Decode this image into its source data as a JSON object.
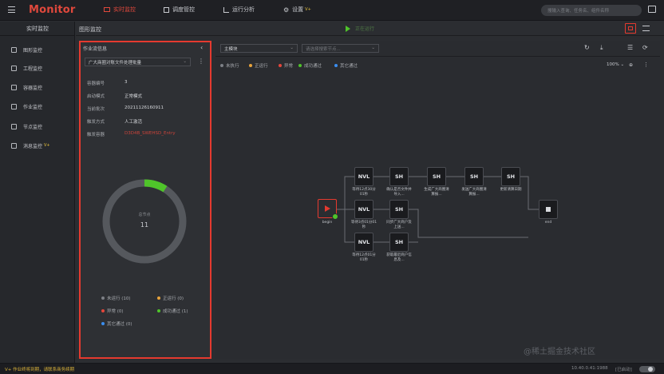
{
  "app": {
    "title": "Monitor"
  },
  "nav": {
    "tabs": [
      {
        "label": "实时监控",
        "active": true
      },
      {
        "label": "调度管控",
        "active": false
      },
      {
        "label": "运行分析",
        "active": false
      },
      {
        "label": "设置",
        "active": false,
        "badge": "V+"
      }
    ],
    "search_placeholder": "搜输入查询、任务名、组件名称"
  },
  "sidebar": {
    "title": "实时监控",
    "items": [
      {
        "label": "图形监控"
      },
      {
        "label": "工程监控"
      },
      {
        "label": "容器监控"
      },
      {
        "label": "作业监控"
      },
      {
        "label": "节点监控"
      },
      {
        "label": "消息监控",
        "badge": "V+"
      }
    ]
  },
  "header": {
    "title": "图形监控",
    "status": "正在运行"
  },
  "panel": {
    "title": "作业流信息",
    "job_select": "广大商圈对账文件处理批量",
    "fields": [
      {
        "label": "容器编号",
        "value": "3"
      },
      {
        "label": "启动模式",
        "value": "正常模式"
      },
      {
        "label": "当前批次",
        "value": "20211126160911"
      },
      {
        "label": "触发方式",
        "value": "人工激活"
      },
      {
        "label": "触发容器",
        "value": "D3D4B_SWEHSD_Entry"
      }
    ],
    "donut": {
      "center_label": "总节点",
      "total": "11",
      "completed": 1
    },
    "legend": [
      {
        "label": "未运行 (10)",
        "color": "#7d8086"
      },
      {
        "label": "正运行 (0)",
        "color": "#e8a33c"
      },
      {
        "label": "异常 (0)",
        "color": "#e5463b"
      },
      {
        "label": "成功通过 (1)",
        "color": "#4fc42a"
      },
      {
        "label": "其它通过 (0)",
        "color": "#3a8ef0"
      }
    ]
  },
  "canvas": {
    "module_select": "主模块",
    "node_search_placeholder": "请选择搜索节点...",
    "zoom": "100%",
    "legend": [
      {
        "label": "未执行",
        "color": "#7d8086"
      },
      {
        "label": "正运行",
        "color": "#e8a33c"
      },
      {
        "label": "异常",
        "color": "#e5463b"
      },
      {
        "label": "成功通过",
        "color": "#4fc42a"
      },
      {
        "label": "其它通过",
        "color": "#3a8ef0"
      }
    ],
    "nodes": {
      "begin": "begin",
      "end": "end",
      "row1": [
        {
          "type": "NVL",
          "label": "等待12点30分01秒"
        },
        {
          "type": "SH",
          "label": "确认是否文件并导入..."
        },
        {
          "type": "SH",
          "label": "生成广大商圈清算报..."
        },
        {
          "type": "SH",
          "label": "发送广大商圈清算报..."
        },
        {
          "type": "SH",
          "label": "更新清算日期"
        }
      ],
      "row2": [
        {
          "type": "NVL",
          "label": "等待3点01分01秒"
        },
        {
          "type": "SH",
          "label": "同步广大商户及上送..."
        }
      ],
      "row3": [
        {
          "type": "NVL",
          "label": "等待12点01分01秒"
        },
        {
          "type": "SH",
          "label": "获取最近商户信息及..."
        }
      ]
    }
  },
  "statusbar": {
    "message": "V+ 作业终将到期，请联系商务续期",
    "ip": "10.40.0.41:1988",
    "state": "[已启动]"
  },
  "watermark": "@稀土掘金技术社区"
}
